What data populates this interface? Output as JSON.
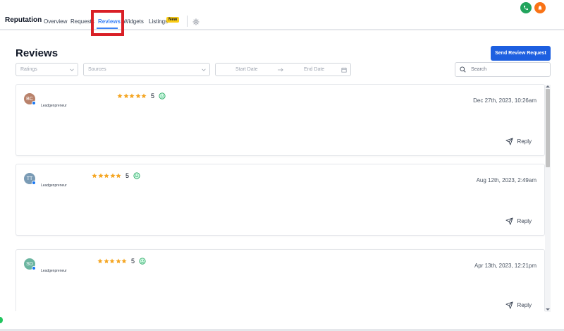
{
  "header": {
    "app_title": "Reputation",
    "tabs": [
      {
        "label": "Overview"
      },
      {
        "label": "Requests"
      },
      {
        "label": "Reviews"
      },
      {
        "label": "Widgets"
      },
      {
        "label": "Listings"
      }
    ],
    "new_badge": "New"
  },
  "page": {
    "title": "Reviews",
    "send_button": "Send Review Request"
  },
  "filters": {
    "ratings_placeholder": "Ratings",
    "sources_placeholder": "Sources",
    "start_date": "Start Date",
    "end_date": "End Date",
    "search_placeholder": "Search"
  },
  "reviews": [
    {
      "initials": "BC",
      "source": "Leadgenpreneur",
      "rating": "5",
      "date": "Dec 27th, 2023, 10:26am",
      "reply": "Reply"
    },
    {
      "initials": "TT",
      "source": "Leadgenpreneur",
      "rating": "5",
      "date": "Aug 12th, 2023, 2:49am",
      "reply": "Reply"
    },
    {
      "initials": "SD",
      "source": "Leadgenpreneur",
      "rating": "5",
      "date": "Apr 13th, 2023, 12:21pm",
      "reply": "Reply"
    }
  ],
  "colors": {
    "accent": "#3b82f6",
    "primary_button": "#1d5fe0",
    "star": "#f5a623",
    "highlight": "#d91f26"
  }
}
